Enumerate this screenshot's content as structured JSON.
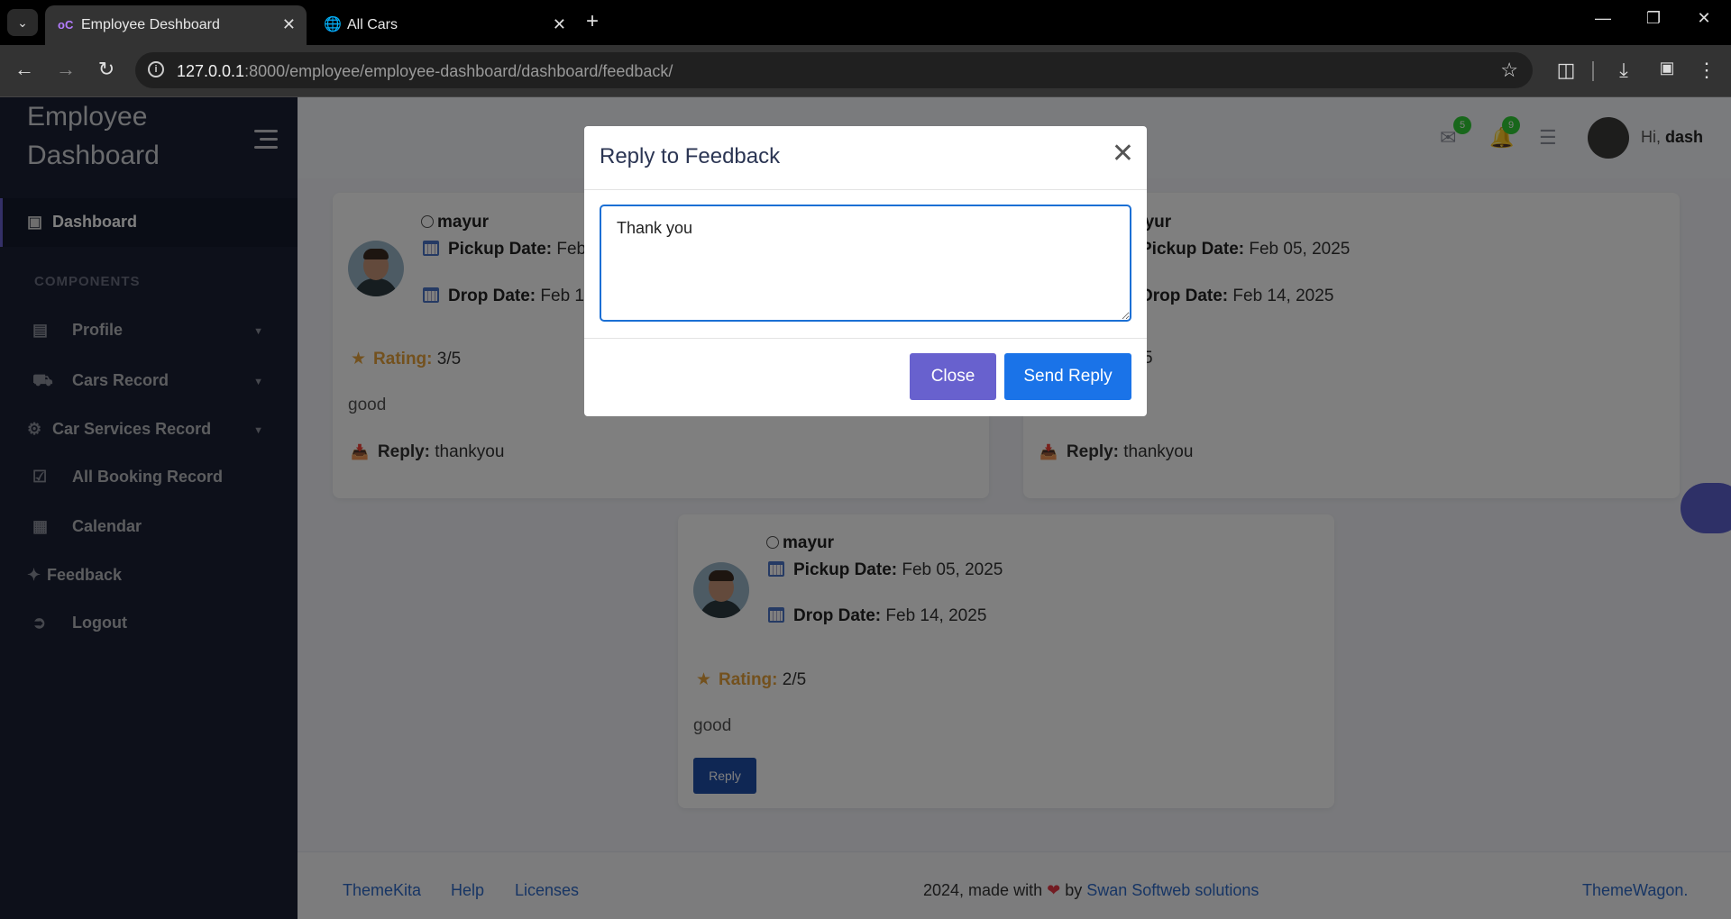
{
  "browser": {
    "tabs": [
      {
        "title": "Employee Deshboard",
        "active": true
      },
      {
        "title": "All Cars",
        "active": false
      }
    ],
    "url_host": "127.0.0.1",
    "url_path": ":8000/employee/employee-dashboard/dashboard/feedback/"
  },
  "sidebar": {
    "brand": "Employee Dashboard",
    "dashboard": "Dashboard",
    "section": "COMPONENTS",
    "items": [
      {
        "label": "Profile",
        "icon": "id-card-icon",
        "caret": true
      },
      {
        "label": "Cars Record",
        "icon": "car-icon",
        "caret": true
      },
      {
        "label": "Car Services Record",
        "icon": "car-services-icon",
        "caret": true
      },
      {
        "label": "All Booking Record",
        "icon": "calendar-check-icon",
        "caret": false
      },
      {
        "label": "Calendar",
        "icon": "calendar-icon",
        "caret": false
      },
      {
        "label": "Feedback",
        "icon": "sparkle-icon",
        "caret": false
      },
      {
        "label": "Logout",
        "icon": "logout-icon",
        "caret": false
      }
    ]
  },
  "header": {
    "messages_count": "5",
    "notifications_count": "9",
    "greeting": "Hi,",
    "username": "dash"
  },
  "feedback": [
    {
      "name": "mayur",
      "pickup_label": "Pickup Date:",
      "pickup": "Feb",
      "drop_label": "Drop Date:",
      "drop": "Feb 1",
      "rating_label": "Rating:",
      "rating": "3/5",
      "comment": "good",
      "reply_label": "Reply:",
      "reply": "thankyou"
    },
    {
      "name": "ayur",
      "pickup_label": "Pickup Date:",
      "pickup": "Feb 05, 2025",
      "drop_label": "Drop Date:",
      "drop": "Feb 14, 2025",
      "rating": "5",
      "reply_label": "Reply:",
      "reply": "thankyou"
    },
    {
      "name": "mayur",
      "pickup_label": "Pickup Date:",
      "pickup": "Feb 05, 2025",
      "drop_label": "Drop Date:",
      "drop": "Feb 14, 2025",
      "rating_label": "Rating:",
      "rating": "2/5",
      "comment": "good",
      "reply_button": "Reply"
    }
  ],
  "footer": {
    "links": [
      "ThemeKita",
      "Help",
      "Licenses"
    ],
    "copy_prefix": "2024, made with",
    "copy_by": "by",
    "company": "Swan Softweb solutions",
    "right": "ThemeWagon."
  },
  "modal": {
    "title": "Reply to Feedback",
    "text": "Thank you",
    "close": "Close",
    "send": "Send Reply"
  },
  "colors": {
    "sidebar_bg": "#1a2035",
    "accent": "#6861ce",
    "primary": "#1a73e8",
    "badge": "#31ce36",
    "rating": "#e6a23c"
  }
}
